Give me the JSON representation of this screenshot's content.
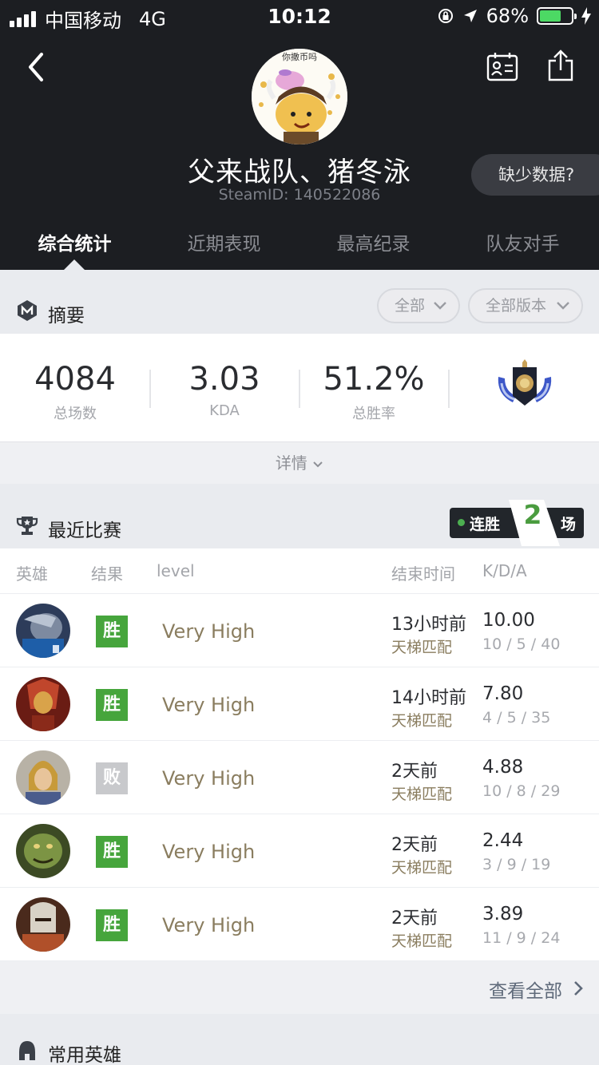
{
  "status_bar": {
    "carrier": "中国移动",
    "network": "4G",
    "time": "10:12",
    "battery_percent": "68%",
    "battery_level": 0.68
  },
  "profile": {
    "name": "父来战队、猪冬泳",
    "steam_id": "SteamID: 140522086",
    "avatar_caption": "你撒币吗",
    "missing_data_label": "缺少数据?"
  },
  "tabs": [
    {
      "label": "综合统计",
      "active": true
    },
    {
      "label": "近期表现",
      "active": false
    },
    {
      "label": "最高纪录",
      "active": false
    },
    {
      "label": "队友对手",
      "active": false
    }
  ],
  "summary": {
    "title": "摘要",
    "filter_all": "全部",
    "filter_version": "全部版本",
    "stats": [
      {
        "value": "4084",
        "label": "总场数"
      },
      {
        "value": "3.03",
        "label": "KDA"
      },
      {
        "value": "51.2%",
        "label": "总胜率"
      }
    ],
    "details_label": "详情"
  },
  "recent": {
    "title": "最近比赛",
    "streak_label": "连胜",
    "streak_count": "2",
    "streak_unit": "场",
    "columns": {
      "hero": "英雄",
      "result": "结果",
      "level": "level",
      "end_time": "结束时间",
      "kda": "K/D/A"
    },
    "matches": [
      {
        "hero": "hero-1",
        "result": "胜",
        "win": true,
        "level": "Very High",
        "time": "13小时前",
        "mode": "天梯匹配",
        "kda": "10.00",
        "kda_detail": "10 / 5 / 40"
      },
      {
        "hero": "hero-2",
        "result": "胜",
        "win": true,
        "level": "Very High",
        "time": "14小时前",
        "mode": "天梯匹配",
        "kda": "7.80",
        "kda_detail": "4 / 5 / 35"
      },
      {
        "hero": "hero-3",
        "result": "败",
        "win": false,
        "level": "Very High",
        "time": "2天前",
        "mode": "天梯匹配",
        "kda": "4.88",
        "kda_detail": "10 / 8 / 29"
      },
      {
        "hero": "hero-4",
        "result": "胜",
        "win": true,
        "level": "Very High",
        "time": "2天前",
        "mode": "天梯匹配",
        "kda": "2.44",
        "kda_detail": "3 / 9 / 19"
      },
      {
        "hero": "hero-5",
        "result": "胜",
        "win": true,
        "level": "Very High",
        "time": "2天前",
        "mode": "天梯匹配",
        "kda": "3.89",
        "kda_detail": "11 / 9 / 24"
      }
    ],
    "view_all_label": "查看全部"
  },
  "heroes": {
    "title": "常用英雄"
  },
  "colors": {
    "win": "#46a53c",
    "loss": "#c8c9cc",
    "header_bg": "#1c1e22",
    "mode_text": "#8a7d5f"
  }
}
